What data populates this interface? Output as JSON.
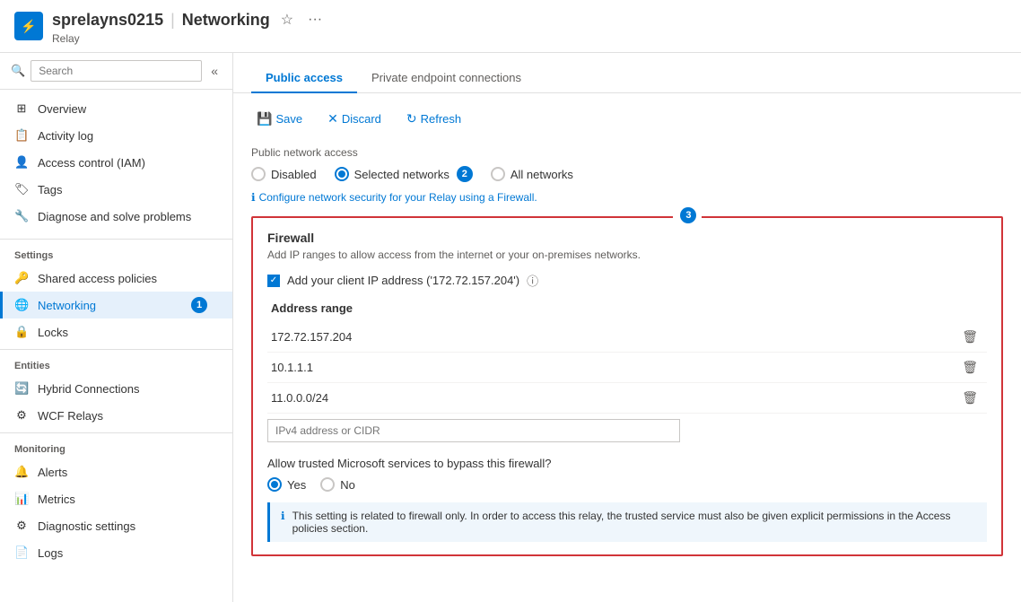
{
  "header": {
    "icon": "⚡",
    "resource": "sprelayns0215",
    "separator": "|",
    "title": "Networking",
    "subtitle": "Relay",
    "favorite_label": "☆",
    "more_label": "···"
  },
  "sidebar": {
    "search_placeholder": "Search",
    "collapse_icon": "«",
    "items": [
      {
        "id": "overview",
        "label": "Overview",
        "icon": "⊞"
      },
      {
        "id": "activity-log",
        "label": "Activity log",
        "icon": "📋"
      },
      {
        "id": "access-control",
        "label": "Access control (IAM)",
        "icon": "👤"
      },
      {
        "id": "tags",
        "label": "Tags",
        "icon": "🏷"
      },
      {
        "id": "diagnose",
        "label": "Diagnose and solve problems",
        "icon": "🔧"
      }
    ],
    "settings_label": "Settings",
    "settings_items": [
      {
        "id": "shared-access-policies",
        "label": "Shared access policies",
        "icon": "🔑"
      },
      {
        "id": "networking",
        "label": "Networking",
        "icon": "🌐",
        "active": true,
        "badge": "1"
      }
    ],
    "locks_item": {
      "id": "locks",
      "label": "Locks",
      "icon": "🔒"
    },
    "entities_label": "Entities",
    "entities_items": [
      {
        "id": "hybrid-connections",
        "label": "Hybrid Connections",
        "icon": "🔄"
      },
      {
        "id": "wcf-relays",
        "label": "WCF Relays",
        "icon": "⚙"
      }
    ],
    "monitoring_label": "Monitoring",
    "monitoring_items": [
      {
        "id": "alerts",
        "label": "Alerts",
        "icon": "🔔"
      },
      {
        "id": "metrics",
        "label": "Metrics",
        "icon": "📊"
      },
      {
        "id": "diagnostic-settings",
        "label": "Diagnostic settings",
        "icon": "⚙"
      },
      {
        "id": "logs",
        "label": "Logs",
        "icon": "📄"
      }
    ]
  },
  "tabs": [
    {
      "id": "public-access",
      "label": "Public access",
      "active": true
    },
    {
      "id": "private-endpoint",
      "label": "Private endpoint connections"
    }
  ],
  "toolbar": {
    "save_label": "Save",
    "discard_label": "Discard",
    "refresh_label": "Refresh"
  },
  "public_network_access": {
    "label": "Public network access",
    "options": [
      {
        "id": "disabled",
        "label": "Disabled",
        "selected": false
      },
      {
        "id": "selected-networks",
        "label": "Selected networks",
        "selected": true,
        "badge": "2"
      },
      {
        "id": "all-networks",
        "label": "All networks",
        "selected": false
      }
    ],
    "info_text": "Configure network security for your Relay using a Firewall.",
    "badge3": "3"
  },
  "firewall": {
    "title": "Firewall",
    "description": "Add IP ranges to allow access from the internet or your on-premises networks.",
    "checkbox_label": "Add your client IP address ('172.72.157.204')",
    "address_range_label": "Address range",
    "addresses": [
      {
        "value": "172.72.157.204"
      },
      {
        "value": "10.1.1.1"
      },
      {
        "value": "11.0.0.0/24"
      }
    ],
    "input_placeholder": "IPv4 address or CIDR",
    "trusted_label": "Allow trusted Microsoft services to bypass this firewall?",
    "trusted_options": [
      {
        "id": "yes",
        "label": "Yes",
        "selected": true
      },
      {
        "id": "no",
        "label": "No",
        "selected": false
      }
    ],
    "info_text": "This setting is related to firewall only. In order to access this relay, the trusted service must also be given explicit permissions in the Access policies section."
  }
}
